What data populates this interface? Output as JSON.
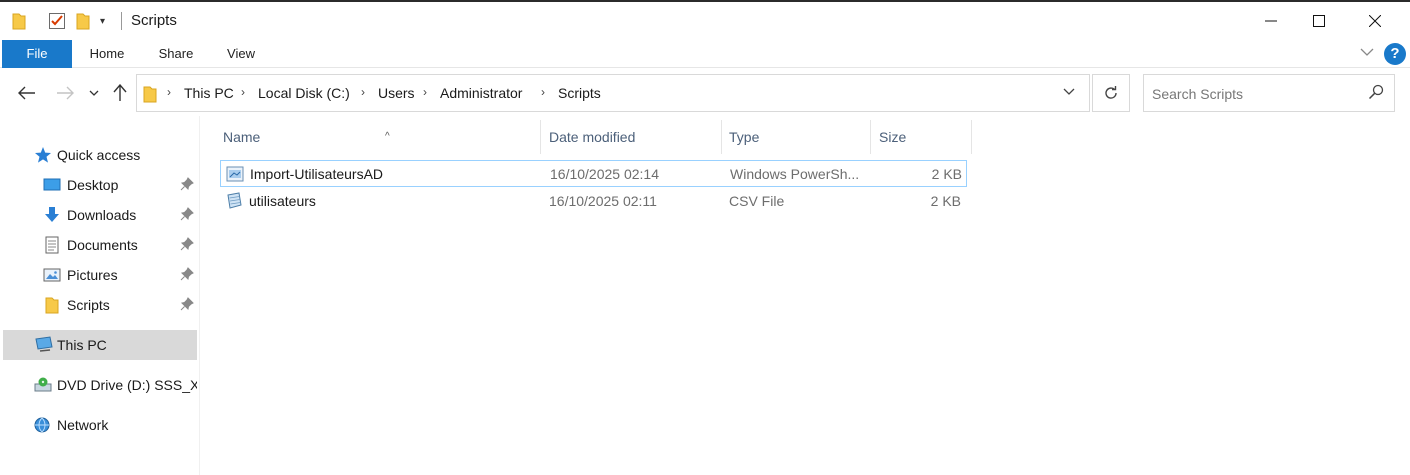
{
  "window": {
    "title": "Scripts",
    "quick_access_toolbar_dropdown": "▾"
  },
  "caption_buttons": {
    "minimize": "—",
    "maximize": "☐",
    "close": "✕"
  },
  "ribbon": {
    "tabs": [
      {
        "label": "File",
        "active": true
      },
      {
        "label": "Home"
      },
      {
        "label": "Share"
      },
      {
        "label": "View"
      }
    ],
    "help_label": "?",
    "expand_label": "⌄"
  },
  "navigation": {
    "back": "←",
    "forward": "→",
    "recent": "⌄",
    "up": "↑"
  },
  "address_bar": {
    "breadcrumbs": [
      "This PC",
      "Local Disk (C:)",
      "Users",
      "Administrator",
      "Scripts"
    ],
    "separator": "›",
    "dropdown": "⌄",
    "refresh": "↻"
  },
  "search": {
    "placeholder": "Search Scripts",
    "value": ""
  },
  "sidebar": {
    "quick_access": {
      "label": "Quick access",
      "items": [
        {
          "label": "Desktop",
          "icon": "desktop-icon",
          "pinned": true
        },
        {
          "label": "Downloads",
          "icon": "downloads-icon",
          "pinned": true
        },
        {
          "label": "Documents",
          "icon": "documents-icon",
          "pinned": true
        },
        {
          "label": "Pictures",
          "icon": "pictures-icon",
          "pinned": true
        },
        {
          "label": "Scripts",
          "icon": "folder-icon",
          "pinned": true
        }
      ]
    },
    "this_pc": {
      "label": "This PC",
      "selected": true
    },
    "dvd_drive": {
      "label": "DVD Drive (D:) SSS_X"
    },
    "network": {
      "label": "Network"
    }
  },
  "file_list": {
    "columns": [
      "Name",
      "Date modified",
      "Type",
      "Size"
    ],
    "sort_indicator": "^",
    "files": [
      {
        "name": "Import-UtilisateursAD",
        "date_modified": "16/10/2025 02:14",
        "type": "Windows PowerSh...",
        "size": "2 KB",
        "icon": "powershell-script-icon",
        "focused": true
      },
      {
        "name": "utilisateurs",
        "date_modified": "16/10/2025 02:11",
        "type": "CSV File",
        "size": "2 KB",
        "icon": "csv-file-icon",
        "focused": false
      }
    ]
  },
  "colors": {
    "accent": "#1979ca",
    "selection": "#d9d9d9",
    "focus_border": "#99d1ff",
    "folder": "#f7c948",
    "column_header_text": "#4c607a"
  }
}
